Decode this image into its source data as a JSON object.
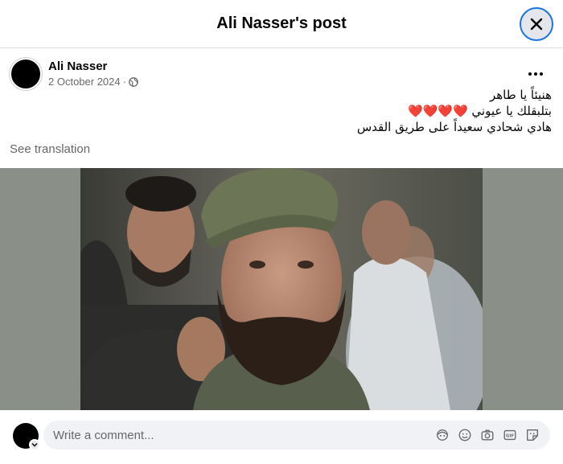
{
  "dialog": {
    "title": "Ali Nasser's post",
    "close_icon": "close-icon"
  },
  "post": {
    "author": "Ali Nasser",
    "date": "2 October 2024",
    "separator": "·",
    "audience_icon": "globe-icon",
    "more_icon": "more-options-icon",
    "text_lines": [
      "هنيئاً يا طاهر",
      "بتلبقلك يا عيوني ❤️❤️❤️❤️",
      "هادي شحادي سعيداً على طريق القدس"
    ],
    "see_translation": "See translation"
  },
  "composer": {
    "placeholder": "Write a comment...",
    "icons": [
      "avatar-sticker-icon",
      "emoji-icon",
      "camera-icon",
      "gif-icon",
      "sticker-icon"
    ]
  },
  "colors": {
    "accent": "#1b74e4",
    "secondary_text": "#65676b",
    "primary_text": "#050505",
    "heart": "#e0245e"
  }
}
